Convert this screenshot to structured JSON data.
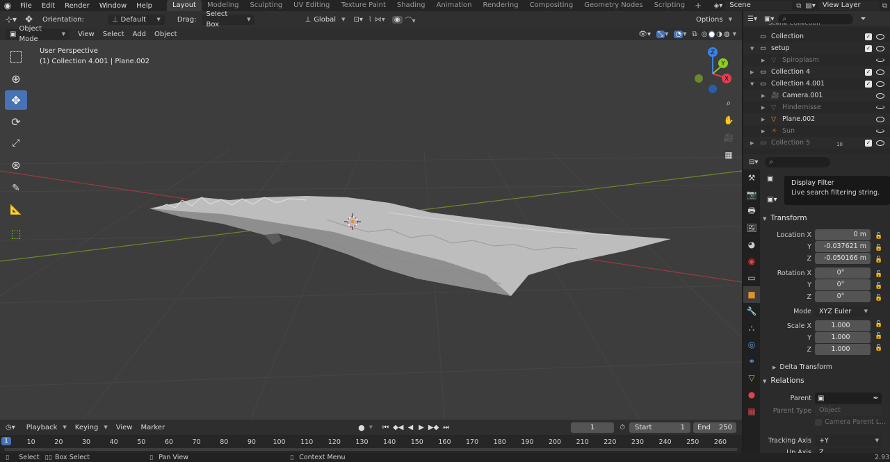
{
  "topbar": {
    "menus": [
      "File",
      "Edit",
      "Render",
      "Window",
      "Help"
    ],
    "workspaces": [
      "Layout",
      "Modeling",
      "Sculpting",
      "UV Editing",
      "Texture Paint",
      "Shading",
      "Animation",
      "Rendering",
      "Compositing",
      "Geometry Nodes",
      "Scripting"
    ],
    "active_workspace": "Layout",
    "scene_name": "Scene",
    "view_layer": "View Layer"
  },
  "viewport_header": {
    "orientation_label": "Orientation:",
    "orientation_value": "Default",
    "drag_label": "Drag:",
    "drag_value": "Select Box",
    "transform_orientation": "Global",
    "options_label": "Options",
    "mode": "Object Mode",
    "menus": [
      "View",
      "Select",
      "Add",
      "Object"
    ]
  },
  "viewport": {
    "perspective_label": "User Perspective",
    "context_label": "(1) Collection 4.001 | Plane.002",
    "gizmo_axes": [
      "Z",
      "Y",
      "X"
    ]
  },
  "outliner": {
    "header_partial": "Scene Collection",
    "rows": [
      {
        "name": "Collection",
        "level": 0,
        "checked": true,
        "dim": false
      },
      {
        "name": "setup",
        "level": 0,
        "checked": true,
        "dim": false
      },
      {
        "name": "Spiroplasm",
        "level": 1,
        "checked": false,
        "dim": true
      },
      {
        "name": "Collection 4",
        "level": 0,
        "checked": true,
        "dim": false
      },
      {
        "name": "Collection 4.001",
        "level": 0,
        "checked": true,
        "dim": false
      },
      {
        "name": "Camera.001",
        "level": 1,
        "checked": false,
        "dim": false
      },
      {
        "name": "Hindernisse",
        "level": 1,
        "checked": false,
        "dim": true
      },
      {
        "name": "Plane.002",
        "level": 1,
        "checked": false,
        "dim": false
      },
      {
        "name": "Sun",
        "level": 1,
        "checked": false,
        "dim": true
      },
      {
        "name": "Collection 5",
        "level": 0,
        "checked": true,
        "dim": true
      }
    ],
    "badge_count": "10"
  },
  "tooltip": {
    "title": "Display Filter",
    "body": "Live search filtering string."
  },
  "properties": {
    "transform_header": "Transform",
    "location_label": "Location X",
    "location": {
      "x": "0 m",
      "y": "-0.037621 m",
      "z": "-0.050166 m"
    },
    "rotation_label": "Rotation X",
    "rotation": {
      "x": "0°",
      "y": "0°",
      "z": "0°"
    },
    "mode_label": "Mode",
    "mode_value": "XYZ Euler",
    "scale_label": "Scale X",
    "scale": {
      "x": "1.000",
      "y": "1.000",
      "z": "1.000"
    },
    "y_label": "Y",
    "z_label": "Z",
    "delta_transform": "Delta Transform",
    "relations_header": "Relations",
    "parent_label": "Parent",
    "parent_type_label": "Parent Type",
    "parent_type_value": "Object",
    "camera_parent_lock": "Camera Parent L...",
    "tracking_axis_label": "Tracking Axis",
    "tracking_axis_value": "+Y",
    "up_axis_partial": "Up Axis",
    "up_axis_value_partial": "Z"
  },
  "timeline": {
    "menus": [
      "Playback",
      "Keying",
      "View",
      "Marker"
    ],
    "current_frame": "1",
    "start_label": "Start",
    "start_value": "1",
    "end_label": "End",
    "end_value": "250",
    "ruler": [
      "1",
      "10",
      "20",
      "30",
      "40",
      "50",
      "60",
      "70",
      "80",
      "90",
      "100",
      "110",
      "120",
      "130",
      "140",
      "150",
      "160",
      "170",
      "180",
      "190",
      "200",
      "210",
      "220",
      "230",
      "240",
      "250",
      "260"
    ]
  },
  "statusbar": {
    "select": "Select",
    "box_select": "Box Select",
    "pan_view": "Pan View",
    "context_menu": "Context Menu",
    "version_partial": "2.93"
  },
  "colors": {
    "accent": "#4772b3",
    "viewport_bg": "#3d3d3d",
    "x_axis": "#e0404f",
    "y_axis": "#8ccd1e",
    "z_axis": "#3b82e0",
    "object_orange": "#e8902e"
  }
}
